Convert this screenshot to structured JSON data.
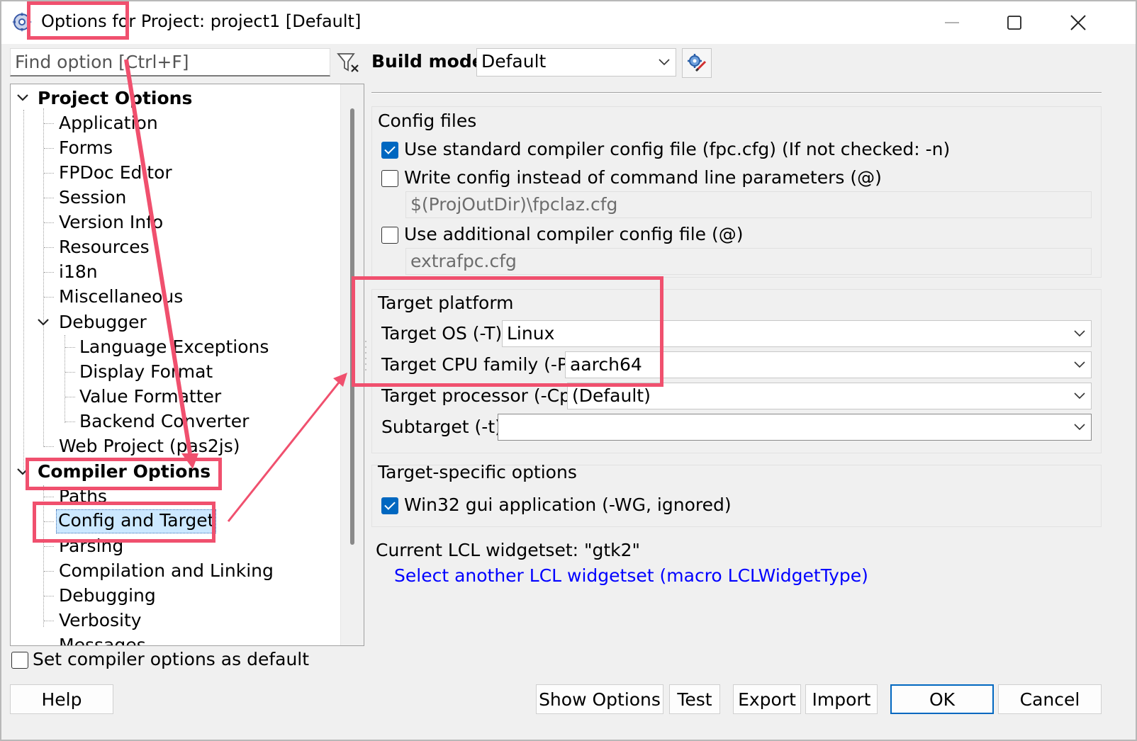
{
  "window": {
    "title": "Options for Project: project1 [Default]"
  },
  "find": {
    "placeholder": "Find option [Ctrl+F]"
  },
  "tree": {
    "project_options": "Project Options",
    "items": [
      "Application",
      "Forms",
      "FPDoc Editor",
      "Session",
      "Version Info",
      "Resources",
      "i18n",
      "Miscellaneous"
    ],
    "debugger": "Debugger",
    "debugger_items": [
      "Language Exceptions",
      "Display Format",
      "Value Formatter",
      "Backend Converter"
    ],
    "web_project": "Web Project (pas2js)",
    "compiler_options": "Compiler Options",
    "compiler_items": [
      "Paths",
      "Config and Target",
      "Parsing",
      "Compilation and Linking",
      "Debugging",
      "Verbosity",
      "Messages"
    ],
    "selected": "Config and Target"
  },
  "build_mode": {
    "label": "Build mode",
    "value": "Default"
  },
  "config_files": {
    "title": "Config files",
    "use_standard": {
      "label": "Use standard compiler config file (fpc.cfg) (If not checked: -n)",
      "checked": true
    },
    "write_config": {
      "label": "Write config instead of command line parameters (@)",
      "checked": false
    },
    "write_config_path": "$(ProjOutDir)\\fpclaz.cfg",
    "use_additional": {
      "label": "Use additional compiler config file (@)",
      "checked": false
    },
    "additional_path": "extrafpc.cfg"
  },
  "target_platform": {
    "title": "Target platform",
    "os_label": "Target OS (-T)",
    "os_value": "Linux",
    "cpu_label": "Target CPU family (-P)",
    "cpu_value": "aarch64",
    "processor_label": "Target processor (-Cp)",
    "processor_value": "(Default)",
    "subtarget_label": "Subtarget (-t)",
    "subtarget_value": ""
  },
  "target_specific": {
    "title": "Target-specific options",
    "win32_gui": {
      "label": "Win32 gui application (-WG, ignored)",
      "checked": true
    }
  },
  "lcl": {
    "current": "Current LCL widgetset: \"gtk2\"",
    "select_link": "Select another LCL widgetset (macro LCLWidgetType)"
  },
  "default_check": {
    "label": "Set compiler options as default",
    "checked": false
  },
  "buttons": {
    "help": "Help",
    "show_options": "Show Options",
    "test": "Test",
    "export": "Export",
    "import": "Import",
    "ok": "OK",
    "cancel": "Cancel"
  },
  "colors": {
    "annotation": "#f0506e",
    "selection": "#cce8ff",
    "checkbox_accent": "#0067c0",
    "link": "#0000ff"
  }
}
